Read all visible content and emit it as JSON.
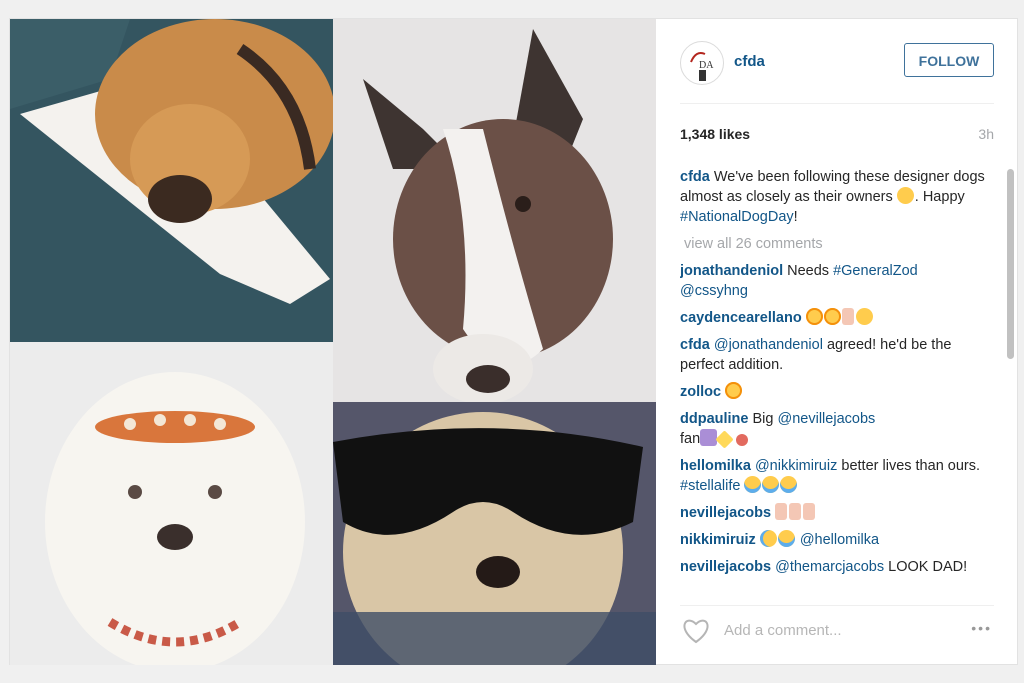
{
  "post": {
    "username": "cfda",
    "follow_label": "FOLLOW",
    "likes": "1,348 likes",
    "time": "3h",
    "caption": {
      "user": "cfda",
      "text1": "We've been following these designer dogs almost as closely as their owners",
      "text2": ". Happy ",
      "hashtag": "#NationalDogDay",
      "text3": "!"
    },
    "view_all": "view all 26 comments",
    "add_comment_placeholder": "Add a comment...",
    "more_label": "•••"
  },
  "comments": [
    {
      "user": "jonathandeniol",
      "text": "Needs ",
      "tag": "#GeneralZod",
      "text2": "",
      "tag2": "@cssyhng"
    },
    {
      "user": "caydencearellano",
      "text": "",
      "tag": "",
      "text2": "",
      "tag2": ""
    },
    {
      "user": "cfda",
      "text": "",
      "tag": "@jonathandeniol",
      "text2": " agreed! he'd be the perfect addition.",
      "tag2": ""
    },
    {
      "user": "zolloc",
      "text": "",
      "tag": "",
      "text2": "",
      "tag2": ""
    },
    {
      "user": "ddpauline",
      "text": "Big ",
      "tag": "@nevillejacobs",
      "text2": " fan",
      "tag2": ""
    },
    {
      "user": "hellomilka",
      "text": "",
      "tag": "@nikkimiruiz",
      "text2": " better lives than ours. ",
      "tag2": "#stellalife"
    },
    {
      "user": "nevillejacobs",
      "text": "",
      "tag": "",
      "text2": "",
      "tag2": ""
    },
    {
      "user": "nikkimiruiz",
      "text": "",
      "tag": "@hellomilka",
      "text2": "",
      "tag2": ""
    },
    {
      "user": "nevillejacobs",
      "text": "",
      "tag": "@themarcjacobs",
      "text2": " LOOK DAD!",
      "tag2": ""
    }
  ],
  "icons": {
    "avatar": "cfda-logo-avatar",
    "heart": "heart-icon",
    "more": "more-options-icon"
  },
  "colors": {
    "link": "#125688",
    "follow": "#3f729b",
    "muted": "#a5a7aa"
  }
}
